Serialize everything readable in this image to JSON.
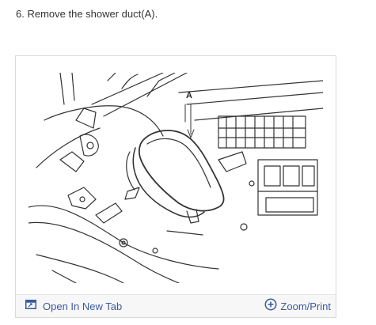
{
  "step": {
    "text": "6. Remove the shower duct(A)."
  },
  "figure": {
    "callout_label": "A",
    "line_color": "#333333"
  },
  "toolbar": {
    "open_tab_label": "Open In New Tab",
    "zoom_label": "Zoom/Print",
    "link_color": "#3b5aa0",
    "icons": {
      "open_tab": "external-tab-icon",
      "zoom": "zoom-plus-icon"
    }
  }
}
